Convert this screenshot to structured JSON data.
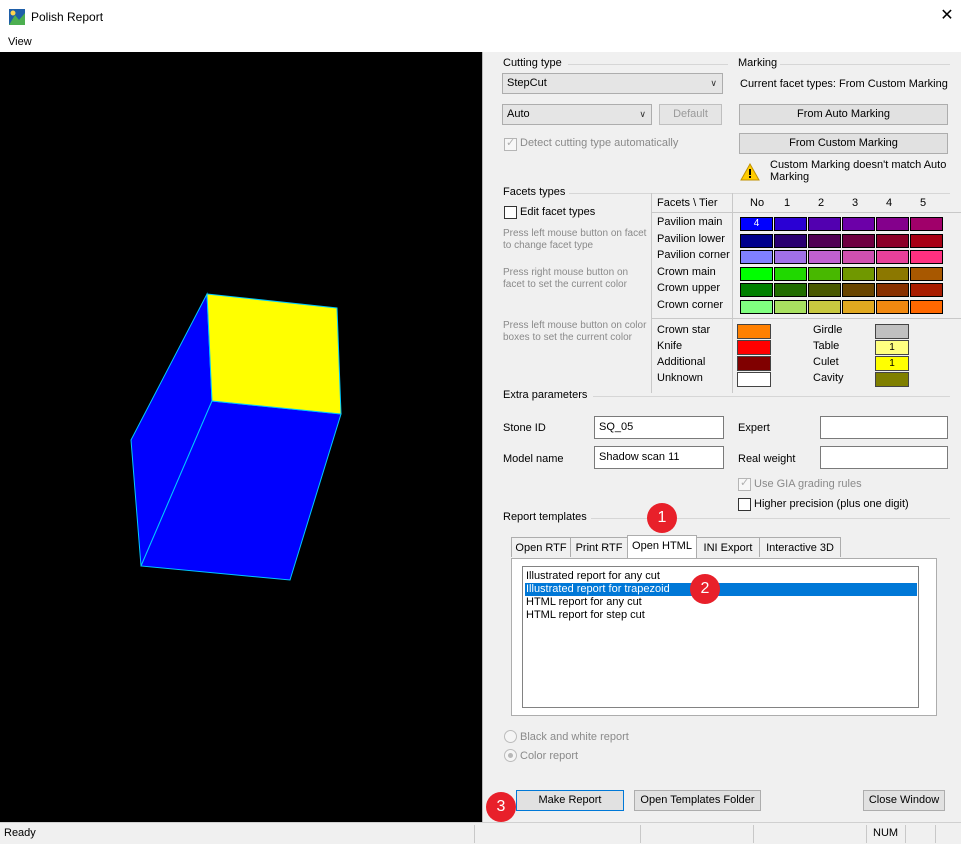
{
  "window": {
    "title": "Polish Report",
    "close_icon": "close-icon"
  },
  "menu": {
    "view": "View"
  },
  "cutting": {
    "title": "Cutting type",
    "type_value": "StepCut",
    "mode_value": "Auto",
    "default_label": "Default",
    "detect_label": "Detect cutting type automatically"
  },
  "marking": {
    "title": "Marking",
    "current": "Current facet types: From Custom Marking",
    "auto_button": "From Auto Marking",
    "custom_button": "From Custom Marking",
    "warning": "Custom Marking doesn't match Auto Marking",
    "warning_icon": "warning-icon"
  },
  "facets": {
    "title": "Facets types",
    "edit_label": "Edit facet types",
    "help1": "Press left mouse button on facet to change facet type",
    "help2": "Press right mouse button on facet to set the current color",
    "help3": "Press left mouse button on color boxes to set the current color",
    "header": "Facets \\ Tier",
    "tiers": [
      "No",
      "1",
      "2",
      "3",
      "4",
      "5"
    ],
    "rows": [
      {
        "name": "Pavilion main",
        "colors": [
          "#0000ff",
          "#2a00d4",
          "#5200b0",
          "#6c00a8",
          "#84008c",
          "#a0006a"
        ],
        "first_text": "4"
      },
      {
        "name": "Pavilion lower",
        "colors": [
          "#00008c",
          "#2a0070",
          "#500054",
          "#6e0040",
          "#8c0028",
          "#a80014"
        ],
        "first_text": ""
      },
      {
        "name": "Pavilion corner",
        "colors": [
          "#8080ff",
          "#a070e8",
          "#c060d0",
          "#d050b0",
          "#e8409a",
          "#ff3080"
        ],
        "first_text": ""
      },
      {
        "name": "Crown main",
        "colors": [
          "#00ff00",
          "#20d800",
          "#48b800",
          "#709800",
          "#8c7800",
          "#a85800"
        ],
        "first_text": ""
      },
      {
        "name": "Crown upper",
        "colors": [
          "#008000",
          "#206c00",
          "#485800",
          "#684400",
          "#883000",
          "#a81c00"
        ],
        "first_text": ""
      },
      {
        "name": "Crown corner",
        "colors": [
          "#80ff80",
          "#a8e060",
          "#c8c840",
          "#e0a820",
          "#f08810",
          "#ff6800"
        ],
        "first_text": ""
      }
    ],
    "others_left": [
      {
        "name": "Crown star",
        "color": "#ff8000",
        "text": ""
      },
      {
        "name": "Knife",
        "color": "#ff0000",
        "text": ""
      },
      {
        "name": "Additional",
        "color": "#800000",
        "text": ""
      },
      {
        "name": "Unknown",
        "color": "#ffffff",
        "text": ""
      }
    ],
    "others_right": [
      {
        "name": "Girdle",
        "color": "#c0c0c0",
        "text": ""
      },
      {
        "name": "Table",
        "color": "#ffff80",
        "text": "1"
      },
      {
        "name": "Culet",
        "color": "#ffff00",
        "text": "1"
      },
      {
        "name": "Cavity",
        "color": "#808000",
        "text": ""
      }
    ]
  },
  "extra": {
    "title": "Extra parameters",
    "stone_id_label": "Stone ID",
    "stone_id_value": "SQ_05",
    "model_label": "Model name",
    "model_value": "Shadow scan 11",
    "expert_label": "Expert",
    "expert_value": "",
    "weight_label": "Real weight",
    "weight_value": "",
    "gia_label": "Use GIA grading rules",
    "precision_label": "Higher precision (plus one digit)"
  },
  "templates": {
    "title": "Report templates",
    "tabs": [
      "Open RTF",
      "Print RTF",
      "Open HTML",
      "INI Export",
      "Interactive 3D"
    ],
    "active_tab": "Open HTML",
    "items": [
      "Illustrated report for any cut",
      "Illustrated report for trapezoid",
      "HTML report for any cut",
      "HTML report for step cut"
    ],
    "selected_item": "Illustrated report for trapezoid",
    "bw_label": "Black and white report",
    "color_label": "Color report"
  },
  "buttons": {
    "make_report": "Make Report",
    "open_folder": "Open Templates Folder",
    "close_window": "Close Window"
  },
  "badges": [
    "1",
    "2",
    "3"
  ],
  "status": {
    "text": "Ready",
    "num": "NUM"
  },
  "viewport": {
    "background": "#000000",
    "top_face_color": "#ffff00",
    "side_face_color": "#0000ff",
    "edge_color": "#00c8ff"
  }
}
